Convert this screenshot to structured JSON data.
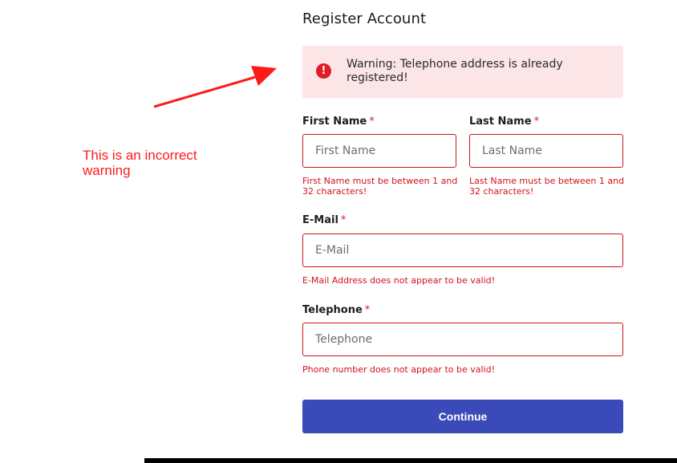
{
  "page": {
    "title": "Register Account"
  },
  "alert": {
    "icon": "exclamation-circle-icon",
    "message": "Warning: Telephone address is already registered!"
  },
  "fields": {
    "first_name": {
      "label": "First Name",
      "required_mark": "*",
      "placeholder": "First Name",
      "error": "First Name must be between 1 and 32 characters!"
    },
    "last_name": {
      "label": "Last Name",
      "required_mark": "*",
      "placeholder": "Last Name",
      "error": "Last Name must be between 1 and 32 characters!"
    },
    "email": {
      "label": "E-Mail",
      "required_mark": "*",
      "placeholder": "E-Mail",
      "error": "E-Mail Address does not appear to be valid!"
    },
    "telephone": {
      "label": "Telephone",
      "required_mark": "*",
      "placeholder": "Telephone",
      "error": "Phone number does not appear to be valid!"
    }
  },
  "actions": {
    "continue_label": "Continue"
  },
  "annotation": {
    "note": "This is an incorrect warning"
  },
  "colors": {
    "error": "#d0121b",
    "alert_bg": "#fbe5e6",
    "button": "#3a4ab9",
    "annotation": "#ff1a1a"
  }
}
